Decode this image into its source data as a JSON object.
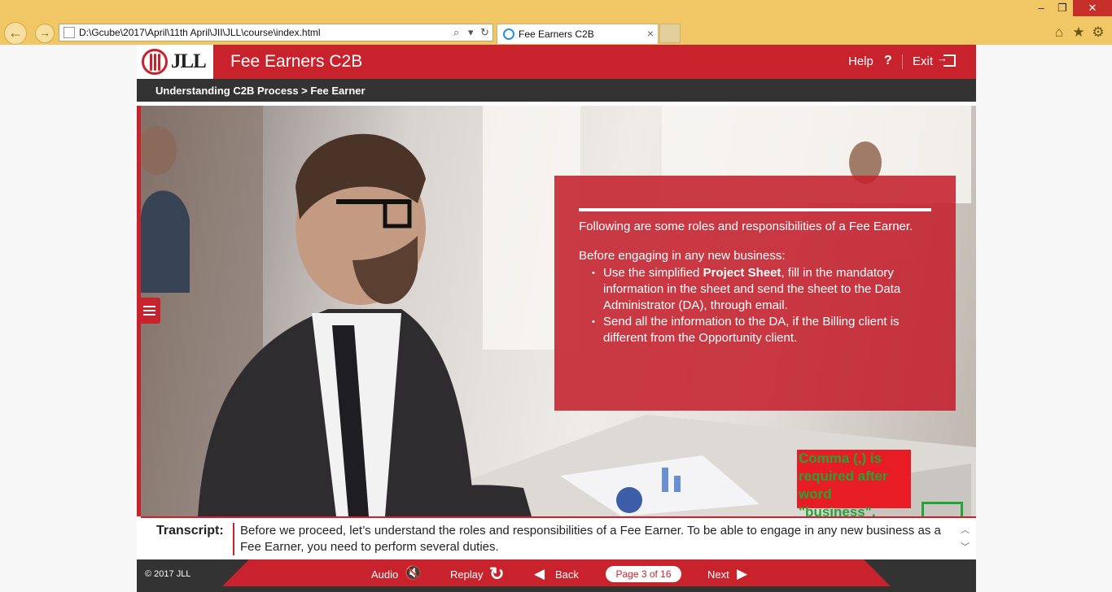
{
  "browser": {
    "url": "D:\\Gcube\\2017\\April\\11th April\\JII\\JLL\\course\\index.html",
    "tab_title": "Fee Earners C2B",
    "tab_close": "×",
    "nav_back": "←",
    "nav_forward": "→",
    "search_glyph": "⌕",
    "dropdown_glyph": "▾",
    "refresh_glyph": "↻",
    "minimize": "–",
    "maximize": "❐",
    "close": "✕",
    "home_icon": "⌂",
    "favorites_icon": "★",
    "tools_icon": "⚙"
  },
  "header": {
    "logo_text": "JLL",
    "title": "Fee Earners C2B",
    "help_label": "Help",
    "help_icon": "?",
    "exit_label": "Exit"
  },
  "breadcrumb": "Understanding C2B Process > Fee Earner",
  "panel": {
    "intro": "Following are some roles and responsibilities of a Fee Earner.",
    "lead": "Before engaging in any new business:",
    "bullet1_pre": "Use the simplified ",
    "bullet1_bold": "Project Sheet",
    "bullet1_post": ", fill in the mandatory information in the sheet and send the sheet to the Data Administrator (DA), through email.",
    "bullet2": "Send all the information to the DA, if the Billing client is different from the Opportunity client."
  },
  "annotation": {
    "text": "Comma (,) is required after word \"business\"."
  },
  "transcript": {
    "label": "Transcript:",
    "text": "Before we proceed, let’s understand the roles and responsibilities of a Fee Earner. To be able to engage in any new business as a Fee Earner, you need to perform several duties.",
    "scroll_up": "︿",
    "scroll_down": "﹀"
  },
  "footer": {
    "copyright": "© 2017 JLL",
    "audio_label": "Audio",
    "audio_icon": "🔇",
    "replay_label": "Replay",
    "replay_icon": "↻",
    "back_label": "Back",
    "back_icon": "◀",
    "page_indicator": "Page 3 of 16",
    "next_label": "Next",
    "next_icon": "▶"
  },
  "colors": {
    "brand_red": "#c8232c",
    "dark_bar": "#333333",
    "chrome_gold": "#f0c764",
    "annotation_red": "#e81c24",
    "annotation_green": "#21a537"
  }
}
